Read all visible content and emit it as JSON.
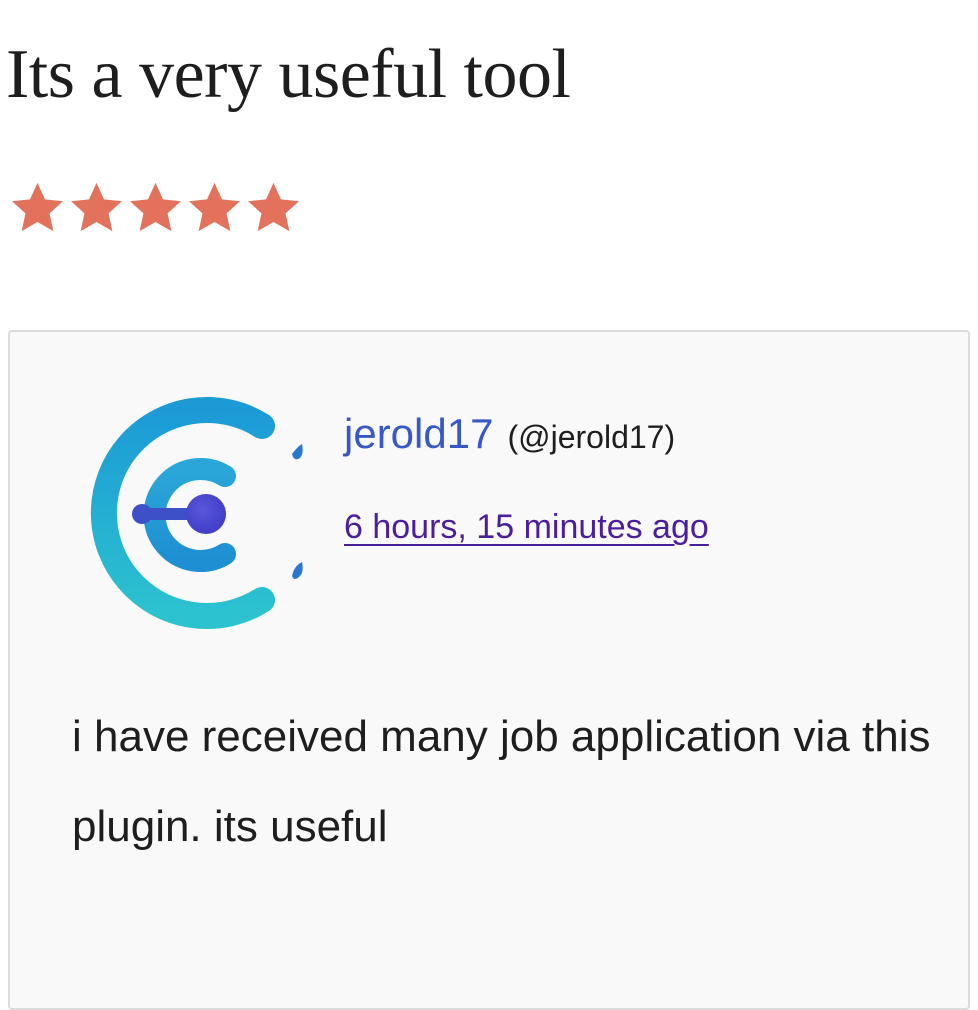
{
  "review": {
    "title": "Its a very useful tool",
    "rating": 5,
    "rating_max": 5,
    "star_color": "#e2725b",
    "author": {
      "name": "jerold17",
      "handle": "(@jerold17)"
    },
    "timestamp": "6 hours, 15 minutes ago",
    "body": "i have received many job application via this plugin. its useful"
  },
  "colors": {
    "author_link": "#3858c6",
    "timestamp_link": "#4b1e9c",
    "card_background": "#f9f9f9",
    "card_border": "#dcdcdc"
  },
  "icons": {
    "star": "star-icon",
    "avatar": "avatar-logo"
  }
}
